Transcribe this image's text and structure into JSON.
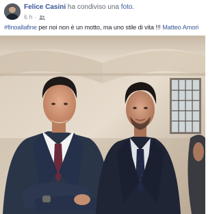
{
  "post": {
    "author": "Felice Casini",
    "action": "ha condiviso una",
    "object": "foto.",
    "time": "6 h",
    "separator": "·",
    "audience_icon": "friends-icon",
    "caption": {
      "hashtag": "#finoallafine",
      "text": " per noi non è un motto, ma uno stile di vita !!! ",
      "mention": "Matteo Amori"
    }
  },
  "colors": {
    "link": "#385898",
    "text": "#1d2129",
    "meta": "#90949c"
  }
}
